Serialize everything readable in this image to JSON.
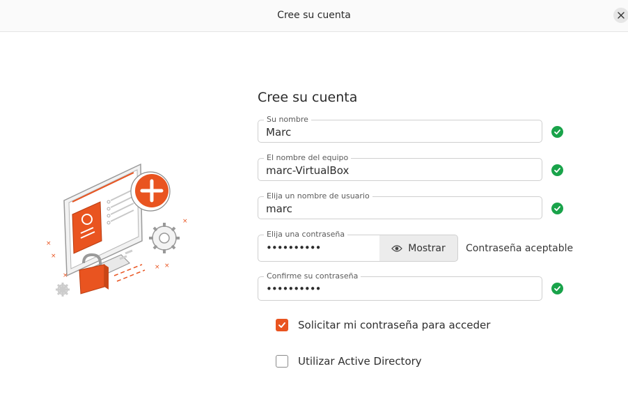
{
  "window": {
    "title": "Cree su cuenta",
    "close_icon": "close-icon"
  },
  "form": {
    "title": "Cree su cuenta",
    "name": {
      "label": "Su nombre",
      "value": "Marc"
    },
    "computer": {
      "label": "El nombre del equipo",
      "value": "marc-VirtualBox"
    },
    "username": {
      "label": "Elija un nombre de usuario",
      "value": "marc"
    },
    "password": {
      "label": "Elija una contraseña",
      "value": "••••••••••",
      "show_label": "Mostrar",
      "status": "Contraseña aceptable"
    },
    "confirm": {
      "label": "Confirme su contraseña",
      "value": "••••••••••"
    },
    "require_password": {
      "label": "Solicitar mi contraseña para acceder",
      "checked": true
    },
    "active_directory": {
      "label": "Utilizar Active Directory",
      "checked": false
    }
  },
  "colors": {
    "accent": "#e95420",
    "valid": "#19a34a",
    "border": "#cfcfcf"
  }
}
